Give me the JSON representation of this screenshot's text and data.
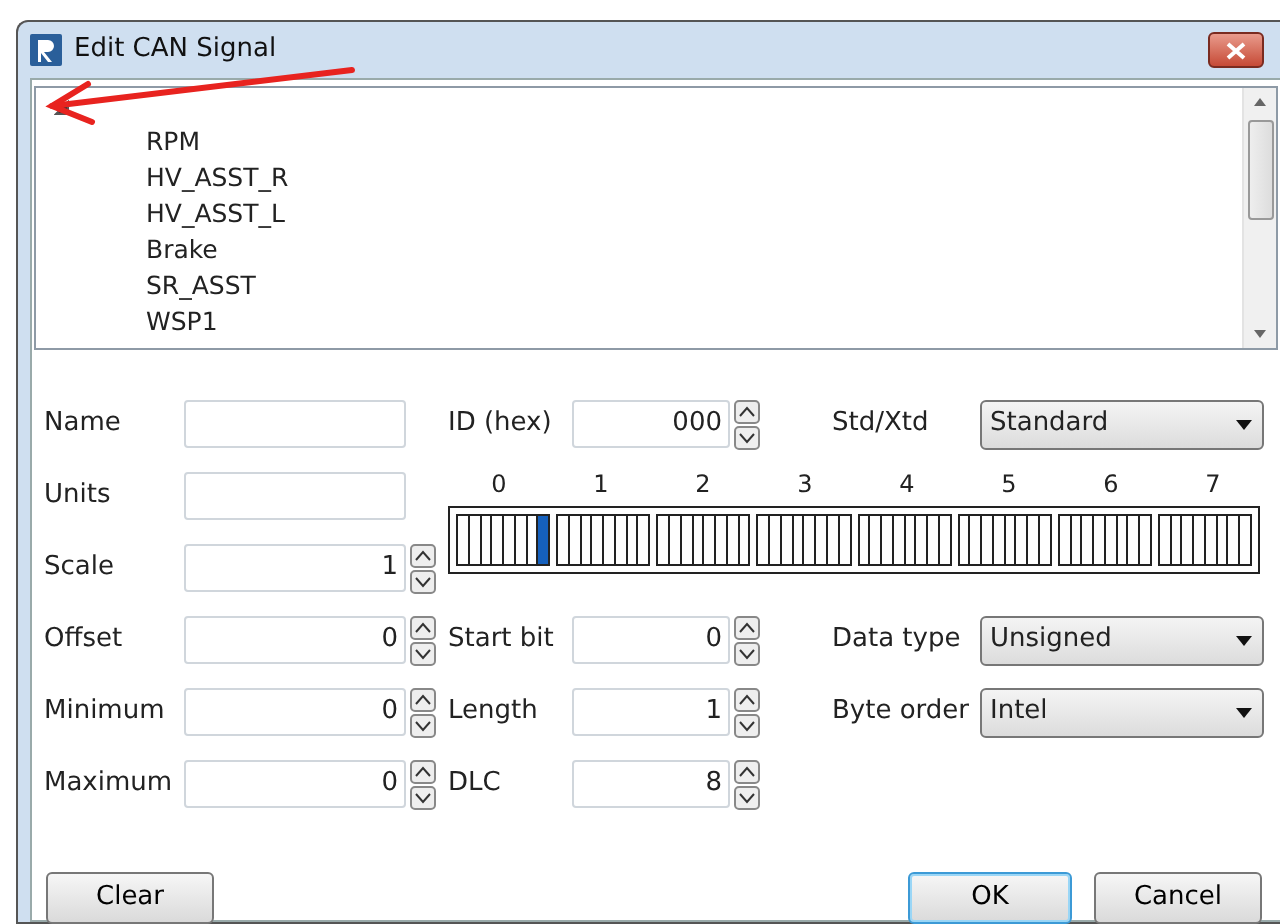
{
  "window": {
    "title": "Edit CAN Signal"
  },
  "tree": {
    "root": {
      "expanded": true,
      "children": [
        {
          "label": "RPM"
        },
        {
          "label": "HV_ASST_R"
        },
        {
          "label": "HV_ASST_L"
        },
        {
          "label": "Brake"
        },
        {
          "label": "SR_ASST"
        },
        {
          "label": "WSP1"
        }
      ]
    }
  },
  "left_fields": [
    {
      "label": "Name",
      "kind": "text"
    },
    {
      "label": "Units",
      "kind": "text"
    },
    {
      "label": "Scale",
      "kind": "spin",
      "value": "1"
    },
    {
      "label": "Offset",
      "kind": "spin",
      "value": "0"
    },
    {
      "label": "Minimum",
      "kind": "spin",
      "value": "0"
    },
    {
      "label": "Maximum",
      "kind": "spin",
      "value": "0"
    }
  ],
  "middle_fields": [
    {
      "label": "ID (hex)",
      "value": "000"
    },
    {
      "label": "Start bit",
      "value": "0"
    },
    {
      "label": "Length",
      "value": "1"
    },
    {
      "label": "DLC",
      "value": "8"
    }
  ],
  "right_fields": [
    {
      "label": "Std/Xtd",
      "value": "Standard"
    },
    {
      "label": "Data type",
      "value": "Unsigned"
    },
    {
      "label": "Byte order",
      "value": "Intel"
    }
  ],
  "bit_grid": {
    "bytes": [
      {
        "label": "0",
        "bits": [
          {
            "selected": false
          },
          {
            "selected": false
          },
          {
            "selected": false
          },
          {
            "selected": false
          },
          {
            "selected": false
          },
          {
            "selected": false
          },
          {
            "selected": false
          },
          {
            "selected": true
          }
        ]
      },
      {
        "label": "1",
        "bits": [
          {
            "selected": false
          },
          {
            "selected": false
          },
          {
            "selected": false
          },
          {
            "selected": false
          },
          {
            "selected": false
          },
          {
            "selected": false
          },
          {
            "selected": false
          },
          {
            "selected": false
          }
        ]
      },
      {
        "label": "2",
        "bits": [
          {
            "selected": false
          },
          {
            "selected": false
          },
          {
            "selected": false
          },
          {
            "selected": false
          },
          {
            "selected": false
          },
          {
            "selected": false
          },
          {
            "selected": false
          },
          {
            "selected": false
          }
        ]
      },
      {
        "label": "3",
        "bits": [
          {
            "selected": false
          },
          {
            "selected": false
          },
          {
            "selected": false
          },
          {
            "selected": false
          },
          {
            "selected": false
          },
          {
            "selected": false
          },
          {
            "selected": false
          },
          {
            "selected": false
          }
        ]
      },
      {
        "label": "4",
        "bits": [
          {
            "selected": false
          },
          {
            "selected": false
          },
          {
            "selected": false
          },
          {
            "selected": false
          },
          {
            "selected": false
          },
          {
            "selected": false
          },
          {
            "selected": false
          },
          {
            "selected": false
          }
        ]
      },
      {
        "label": "5",
        "bits": [
          {
            "selected": false
          },
          {
            "selected": false
          },
          {
            "selected": false
          },
          {
            "selected": false
          },
          {
            "selected": false
          },
          {
            "selected": false
          },
          {
            "selected": false
          },
          {
            "selected": false
          }
        ]
      },
      {
        "label": "6",
        "bits": [
          {
            "selected": false
          },
          {
            "selected": false
          },
          {
            "selected": false
          },
          {
            "selected": false
          },
          {
            "selected": false
          },
          {
            "selected": false
          },
          {
            "selected": false
          },
          {
            "selected": false
          }
        ]
      },
      {
        "label": "7",
        "bits": [
          {
            "selected": false
          },
          {
            "selected": false
          },
          {
            "selected": false
          },
          {
            "selected": false
          },
          {
            "selected": false
          },
          {
            "selected": false
          },
          {
            "selected": false
          },
          {
            "selected": false
          }
        ]
      }
    ]
  },
  "buttons": [
    {
      "label": "Clear",
      "default": false
    },
    {
      "label": "OK",
      "default": true
    },
    {
      "label": "Cancel",
      "default": false
    }
  ]
}
